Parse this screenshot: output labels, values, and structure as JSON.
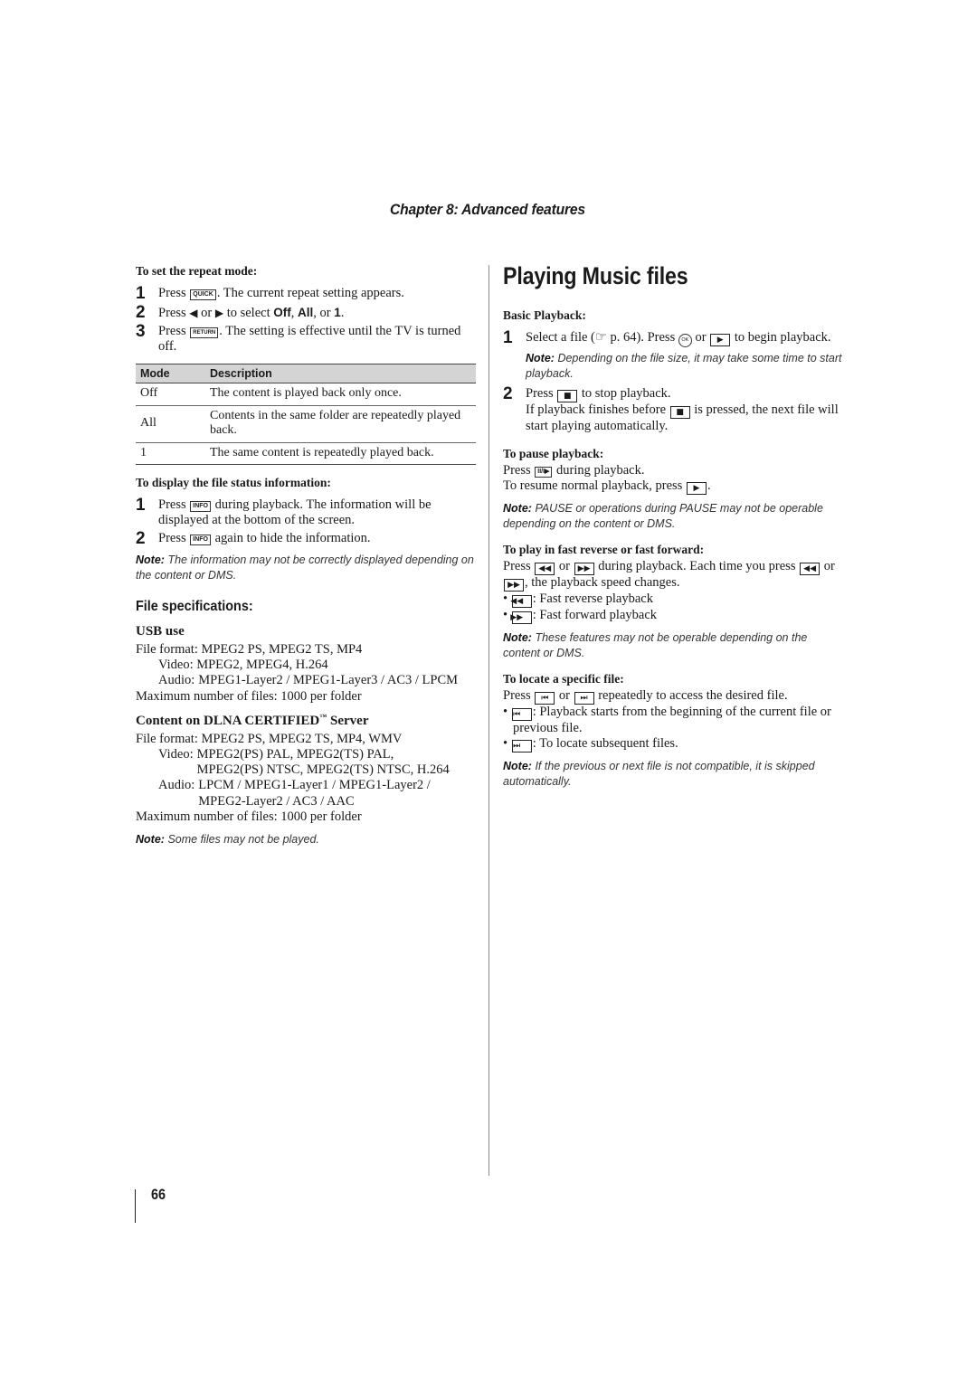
{
  "header": {
    "chapter": "Chapter 8: Advanced features"
  },
  "left": {
    "repeat": {
      "heading": "To set the repeat mode:",
      "steps": [
        {
          "num": "1",
          "pre": "Press",
          "key": "QUICK",
          "post": ". The current repeat setting appears."
        },
        {
          "num": "2",
          "pre": "Press",
          "mid1": "or",
          "mid2": "to select",
          "opt1": "Off",
          "sep1": ",",
          "opt2": "All",
          "sep2": ", or",
          "opt3": "1",
          "end": "."
        },
        {
          "num": "3",
          "pre": "Press",
          "key": "RETURN",
          "post": ". The setting is effective until the TV is turned off."
        }
      ],
      "table": {
        "headers": [
          "Mode",
          "Description"
        ],
        "rows": [
          [
            "Off",
            "The content is played back only once."
          ],
          [
            "All",
            "Contents in the same folder are repeatedly played back."
          ],
          [
            "1",
            "The same content is repeatedly played back."
          ]
        ]
      }
    },
    "status": {
      "heading": "To display the file status information:",
      "steps": [
        {
          "num": "1",
          "pre": "Press",
          "key": "INFO",
          "post": "during playback. The information will be displayed at the bottom of the screen."
        },
        {
          "num": "2",
          "pre": "Press",
          "key": "INFO",
          "post": "again to hide the information."
        }
      ],
      "note_label": "Note:",
      "note": "The information may not be correctly displayed depending on the content or DMS."
    },
    "specs": {
      "heading": "File specifications:",
      "usb": {
        "heading": "USB use",
        "file_format": "File format: MPEG2 PS, MPEG2 TS, MP4",
        "video": "Video: MPEG2, MPEG4, H.264",
        "audio_label": "Audio:",
        "audio": "MPEG1-Layer2 / MPEG1-Layer3 / AC3 / LPCM",
        "max": "Maximum number of files: 1000 per folder"
      },
      "dlna": {
        "heading_pre": "Content on DLNA CERTIFIED",
        "tm": "™",
        "heading_post": " Server",
        "file_format": "File format: MPEG2 PS, MPEG2 TS, MP4, WMV",
        "video_label": "Video:",
        "video": "MPEG2(PS) PAL, MPEG2(TS) PAL, MPEG2(PS) NTSC, MPEG2(TS) NTSC, H.264",
        "audio_label": "Audio:",
        "audio": "LPCM / MPEG1-Layer1 / MPEG1-Layer2 / MPEG2-Layer2 / AC3 / AAC",
        "max": "Maximum number of files: 1000 per folder"
      },
      "note_label": "Note:",
      "note": "Some files may not be played."
    }
  },
  "right": {
    "title": "Playing Music files",
    "basic": {
      "heading": "Basic Playback:",
      "step1": {
        "num": "1",
        "pre": "Select a file (",
        "ref_icon": "☞",
        "ref": "p. 64). Press",
        "ok": "OK",
        "or": "or",
        "post": "to begin playback."
      },
      "note1_label": "Note:",
      "note1": "Depending on the file size, it may take some time to start playback.",
      "step2": {
        "num": "2",
        "pre": "Press",
        "post": "to stop playback.",
        "line2_pre": "If playback finishes before",
        "line2_post": "is pressed, the next file will start playing automatically."
      }
    },
    "pause": {
      "heading": "To pause playback:",
      "line1_pre": "Press",
      "line1_key": "II/I▶",
      "line1_post": "during playback.",
      "line2": "To resume normal playback, press",
      "line2_end": ".",
      "note_label": "Note:",
      "note": "PAUSE or operations during PAUSE may not be operable depending on the content or DMS."
    },
    "ffrew": {
      "heading": "To play in fast reverse or fast forward:",
      "pre": "Press",
      "or": "or",
      "mid": "during playback. Each time you press",
      "or2": "or",
      "post": ", the playback speed changes.",
      "bullets": [
        ": Fast reverse playback",
        ": Fast forward playback"
      ],
      "note_label": "Note:",
      "note": "These features may not be operable depending on the content or DMS."
    },
    "locate": {
      "heading": "To locate a specific file:",
      "pre": "Press",
      "or": "or",
      "post": "repeatedly to access the desired file.",
      "bullets": [
        ": Playback starts from the beginning of the current file or previous file.",
        ": To locate subsequent files."
      ],
      "note_label": "Note:",
      "note": "If the previous or next file is not compatible, it is skipped automatically."
    }
  },
  "footer": {
    "page_number": "66"
  }
}
